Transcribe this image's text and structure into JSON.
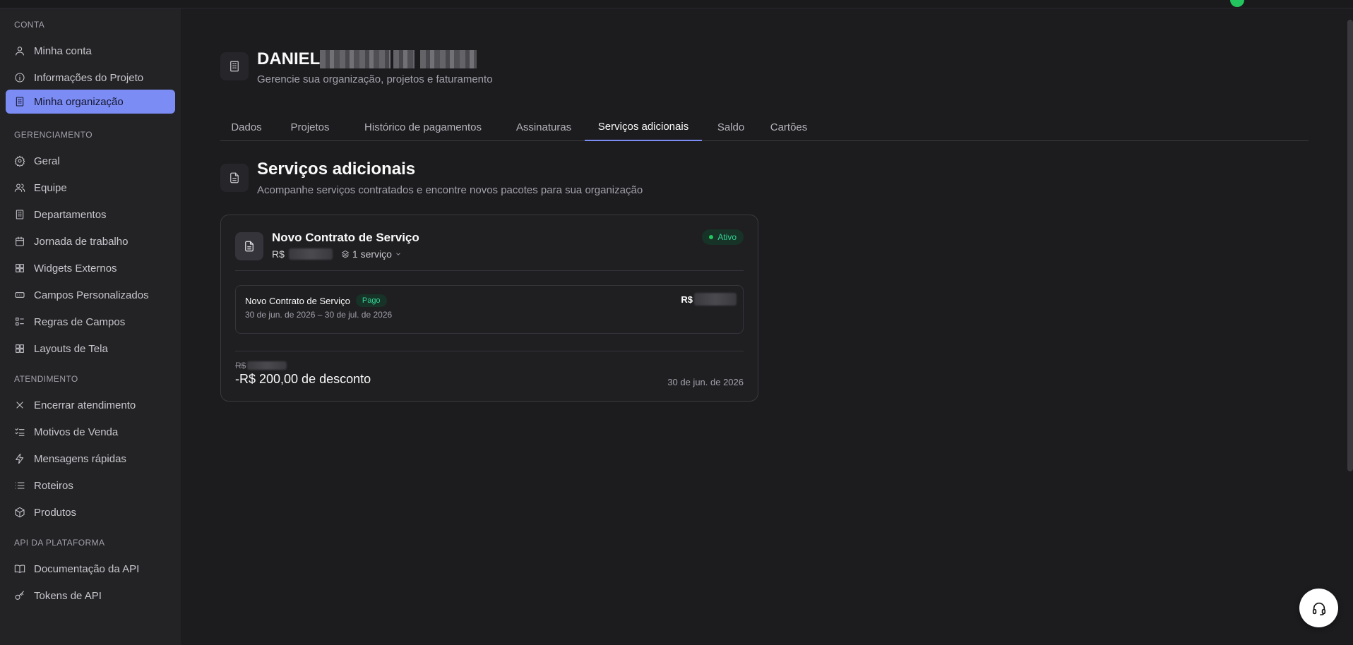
{
  "sidebar": {
    "sections": [
      {
        "title": "CONTA"
      },
      {
        "title": "GERENCIAMENTO"
      },
      {
        "title": "ATENDIMENTO"
      },
      {
        "title": "API DA PLATAFORMA"
      }
    ],
    "items": [
      {
        "label": "Minha conta",
        "icon": "user-icon"
      },
      {
        "label": "Informações do Projeto",
        "icon": "info-icon"
      },
      {
        "label": "Minha organização",
        "icon": "building-icon"
      },
      {
        "label": "Geral",
        "icon": "gear-icon"
      },
      {
        "label": "Equipe",
        "icon": "users-icon"
      },
      {
        "label": "Departamentos",
        "icon": "building-icon"
      },
      {
        "label": "Jornada de trabalho",
        "icon": "calendar-icon"
      },
      {
        "label": "Widgets Externos",
        "icon": "grid-icon"
      },
      {
        "label": "Campos Personalizados",
        "icon": "field-icon"
      },
      {
        "label": "Regras de Campos",
        "icon": "list-check-icon"
      },
      {
        "label": "Layouts de Tela",
        "icon": "layout-icon"
      },
      {
        "label": "Encerrar atendimento",
        "icon": "close-icon"
      },
      {
        "label": "Motivos de Venda",
        "icon": "checklist-icon"
      },
      {
        "label": "Mensagens rápidas",
        "icon": "zap-icon"
      },
      {
        "label": "Roteiros",
        "icon": "list-icon"
      },
      {
        "label": "Produtos",
        "icon": "box-icon"
      },
      {
        "label": "Documentação da API",
        "icon": "book-icon"
      },
      {
        "label": "Tokens de API",
        "icon": "key-icon"
      }
    ],
    "active_item": "Minha organização"
  },
  "header": {
    "org_name": "DANIEL",
    "subtitle": "Gerencie sua organização, projetos e faturamento"
  },
  "tabs": [
    {
      "label": "Dados"
    },
    {
      "label": "Projetos"
    },
    {
      "label": "Histórico de pagamentos"
    },
    {
      "label": "Assinaturas"
    },
    {
      "label": "Serviços adicionais"
    },
    {
      "label": "Saldo"
    },
    {
      "label": "Cartões"
    }
  ],
  "active_tab": "Serviços adicionais",
  "section": {
    "title": "Serviços adicionais",
    "subtitle": "Acompanhe serviços contratados e encontre novos pacotes para sua organização"
  },
  "contract": {
    "title": "Novo Contrato de Serviço",
    "currency": "R$",
    "service_count": "1 serviço",
    "status": "Ativo",
    "line_item": {
      "title": "Novo Contrato de Serviço",
      "badge": "Pago",
      "period": "30 de jun. de 2026 – 30 de jul. de 2026",
      "currency": "R$"
    },
    "original_currency": "R$",
    "discount": "-R$ 200,00 de desconto",
    "date": "30 de jun. de 2026"
  },
  "colors": {
    "accent": "#7c8cf5",
    "success": "#22c55e",
    "background": "#1c1c1f",
    "sidebar": "#232326"
  }
}
